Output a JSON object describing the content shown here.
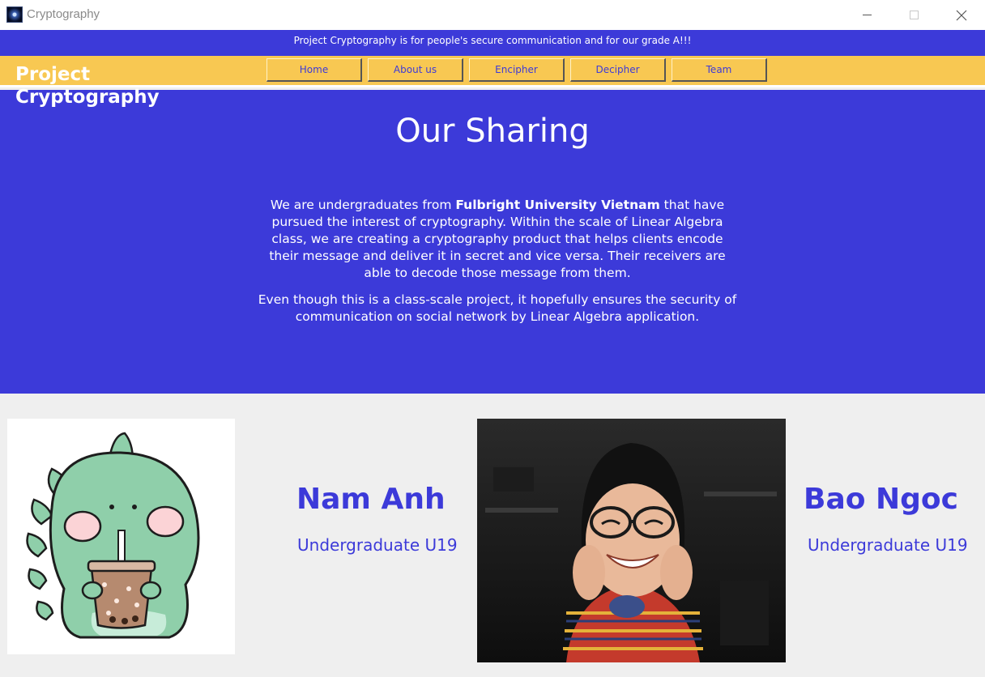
{
  "window": {
    "title": "Cryptography",
    "icon": "app-icon",
    "controls": [
      "minimize-icon",
      "maximize-icon",
      "close-icon"
    ]
  },
  "banner": {
    "text": "Project Cryptography is for people's secure communication and for our grade A!!!"
  },
  "nav": {
    "brand_line1": "Project",
    "brand_line2": "Cryptography",
    "items": [
      {
        "label": "Home"
      },
      {
        "label": "About us"
      },
      {
        "label": "Encipher"
      },
      {
        "label": "Decipher"
      },
      {
        "label": "Team"
      }
    ]
  },
  "hero": {
    "title": "Our Sharing",
    "p1_before": "We are undergraduates from ",
    "p1_bold": "Fulbright University Vietnam",
    "p1_after": " that have pursued the interest of cryptography. Within the scale of Linear Algebra class, we are creating a cryptography product that helps clients encode their message and deliver it in secret and vice versa. Their receivers are able to decode those message from them.",
    "p2": "Even though this is a class-scale project, it hopefully ensures the security of communication on social network by Linear Algebra application."
  },
  "team": [
    {
      "name": "Nam Anh",
      "role": "Undergraduate U19",
      "photo": "dinosaur-boba-illustration"
    },
    {
      "name": "Bao Ngoc",
      "role": "Undergraduate U19",
      "photo": "smiling-student-photo"
    }
  ],
  "colors": {
    "primary_blue": "#3c3ad9",
    "nav_yellow": "#f8c852",
    "page_bg": "#efefef"
  }
}
